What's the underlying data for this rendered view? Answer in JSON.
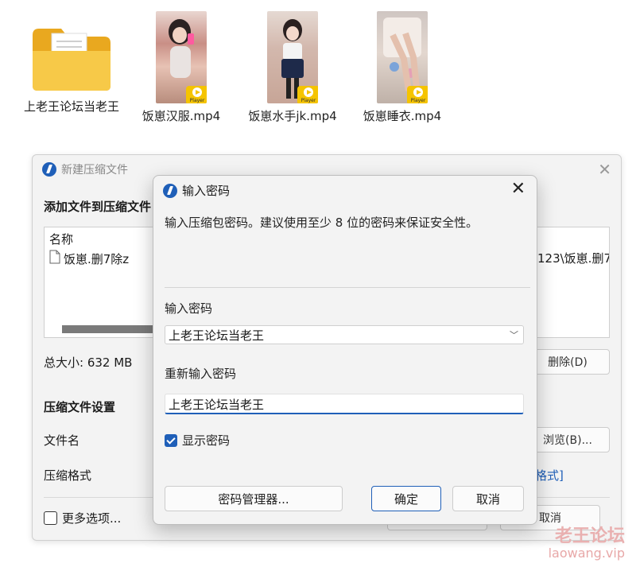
{
  "files": [
    {
      "name": "上老王论坛当老王",
      "type": "folder"
    },
    {
      "name": "饭崽汉服.mp4",
      "type": "video",
      "badge": "Player"
    },
    {
      "name": "饭崽水手jk.mp4",
      "type": "video",
      "badge": "Player"
    },
    {
      "name": "饭崽睡衣.mp4",
      "type": "video",
      "badge": "Player"
    }
  ],
  "bg_dialog": {
    "title": "新建压缩文件",
    "section_add": "添加文件到压缩文件",
    "column_name": "名称",
    "file_item": "饭崽.删7除z",
    "path_text": "123\\饭崽.删7[",
    "total_size": "总大小: 632 MB",
    "delete_button": "删除(D)",
    "settings_heading": "压缩文件设置",
    "filename_label": "文件名",
    "browse_button": "浏览(B)...",
    "format_label": "压缩格式",
    "format_link": "格式]",
    "more_options": "更多选项...",
    "cancel_button": "取消"
  },
  "dialog": {
    "title": "输入密码",
    "description": "输入压缩包密码。建议使用至少 8 位的密码来保证安全性。",
    "password_label": "输入密码",
    "password_value": "上老王论坛当老王",
    "reenter_label": "重新输入密码",
    "reenter_value": "上老王论坛当老王",
    "show_password_label": "显示密码",
    "show_password_checked": true,
    "manager_button": "密码管理器...",
    "ok_button": "确定",
    "cancel_button": "取消"
  },
  "watermark": {
    "text": "老王论坛",
    "url": "laowang.vip"
  },
  "colors": {
    "accent": "#1f5fb8",
    "folder": "#f5c13a",
    "badge": "#f5c400"
  }
}
